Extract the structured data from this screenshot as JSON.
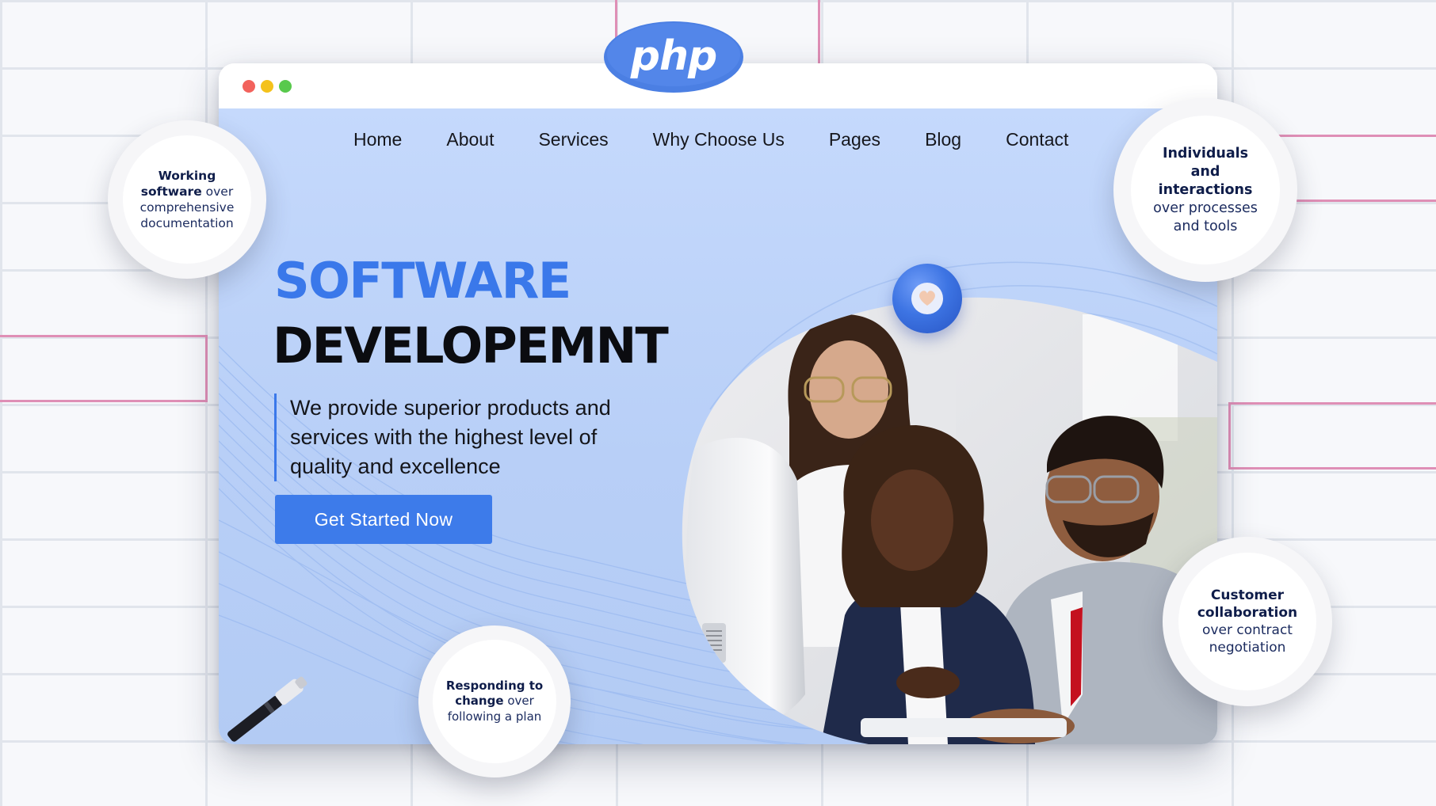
{
  "logo": {
    "text": "php",
    "color": "#4b7fe3"
  },
  "browser": {
    "window_controls": [
      "close",
      "minimize",
      "maximize"
    ],
    "control_colors": {
      "close": "#f2625c",
      "minimize": "#f4c21b",
      "maximize": "#58c94c"
    }
  },
  "nav": {
    "items": [
      {
        "label": "Home"
      },
      {
        "label": "About"
      },
      {
        "label": "Services"
      },
      {
        "label": "Why Choose Us"
      },
      {
        "label": "Pages"
      },
      {
        "label": "Blog"
      },
      {
        "label": "Contact"
      }
    ]
  },
  "hero": {
    "title_line1": "SOFTWARE",
    "title_line2": "DEVELOPEMNT",
    "description": "We provide superior products and services with the highest level of quality and excellence",
    "cta_label": "Get Started Now",
    "accent_color": "#3a78ea"
  },
  "badges": {
    "working_software": {
      "bold": "Working software",
      "rest": "over comprehensive documentation"
    },
    "individuals": {
      "bold": "Individuals and interactions",
      "rest": "over processes and tools"
    },
    "customer": {
      "bold": "Customer collaboration",
      "rest": "over contract negotiation"
    },
    "responding": {
      "bold": "Responding to change",
      "rest": "over following a plan"
    }
  },
  "icons": [
    "heart-icon",
    "pen-icon"
  ]
}
